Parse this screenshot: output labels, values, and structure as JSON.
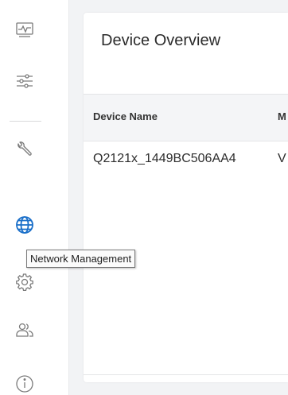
{
  "sidebar": {
    "items": [
      {
        "name": "monitor",
        "icon": "monitor-icon"
      },
      {
        "name": "sliders",
        "icon": "sliders-icon"
      },
      {
        "name": "tools",
        "icon": "wrench-icon"
      },
      {
        "name": "network",
        "icon": "globe-icon"
      },
      {
        "name": "settings",
        "icon": "gear-icon"
      },
      {
        "name": "users",
        "icon": "users-icon"
      },
      {
        "name": "info",
        "icon": "info-icon"
      }
    ],
    "accent_color": "#1a6fc9",
    "icon_color": "#7a7a7a"
  },
  "tooltip": {
    "text": "Network Management"
  },
  "panel": {
    "title": "Device Overview",
    "columns": [
      "Device Name",
      "M"
    ],
    "rows": [
      {
        "device_name": "Q2121x_1449BC506AA4",
        "second": "V"
      }
    ]
  }
}
